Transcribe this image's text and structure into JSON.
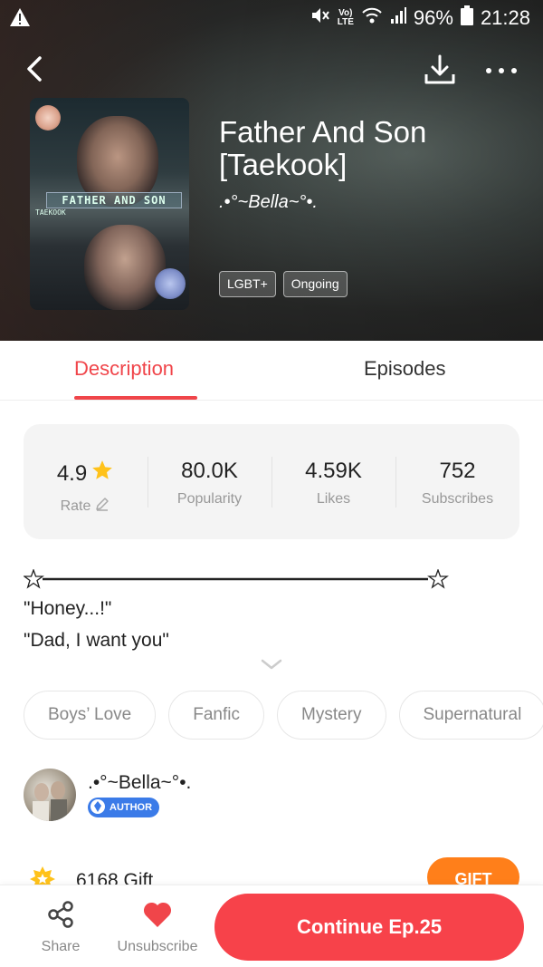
{
  "status_bar": {
    "network_label_top": "Vo)",
    "network_label_bottom": "LTE",
    "battery": "96%",
    "time": "21:28"
  },
  "book": {
    "title": "Father And Son [Taekook]",
    "author": ".•°~Bella~°•.",
    "tags": [
      "LGBT+",
      "Ongoing"
    ],
    "cover_banner": "FATHER AND SON",
    "cover_sub": "TAEKOOK"
  },
  "tabs": {
    "description": "Description",
    "episodes": "Episodes",
    "active": "description"
  },
  "stats": {
    "rate_value": "4.9",
    "rate_label": "Rate",
    "popularity_value": "80.0K",
    "popularity_label": "Popularity",
    "likes_value": "4.59K",
    "likes_label": "Likes",
    "subscribes_value": "752",
    "subscribes_label": "Subscribes"
  },
  "description": {
    "line1": "\"Honey...!\"",
    "line2": "\"Dad, I want you\""
  },
  "genres": [
    "Boys’ Love",
    "Fanfic",
    "Mystery",
    "Supernatural"
  ],
  "author_section": {
    "name": ".•°~Bella~°•.",
    "badge": "AUTHOR"
  },
  "gift": {
    "text": "6168 Gift",
    "button": "GIFT"
  },
  "bottom_bar": {
    "share": "Share",
    "unsubscribe": "Unsubscribe",
    "continue": "Continue Ep.25"
  },
  "colors": {
    "accent_red": "#f0454a",
    "continue_red": "#f7424a",
    "gift_orange": "#ff7f1a",
    "author_badge_blue": "#3b7be8",
    "star_yellow": "#ffc21a"
  },
  "icons": [
    "warning-icon",
    "mute-icon",
    "wifi-icon",
    "signal-icon",
    "battery-icon",
    "back-icon",
    "download-icon",
    "more-icon",
    "star-icon",
    "pencil-icon",
    "star-outline-icon",
    "chevron-down-icon",
    "share-icon",
    "heart-icon",
    "gift-icon",
    "diamond-icon"
  ]
}
